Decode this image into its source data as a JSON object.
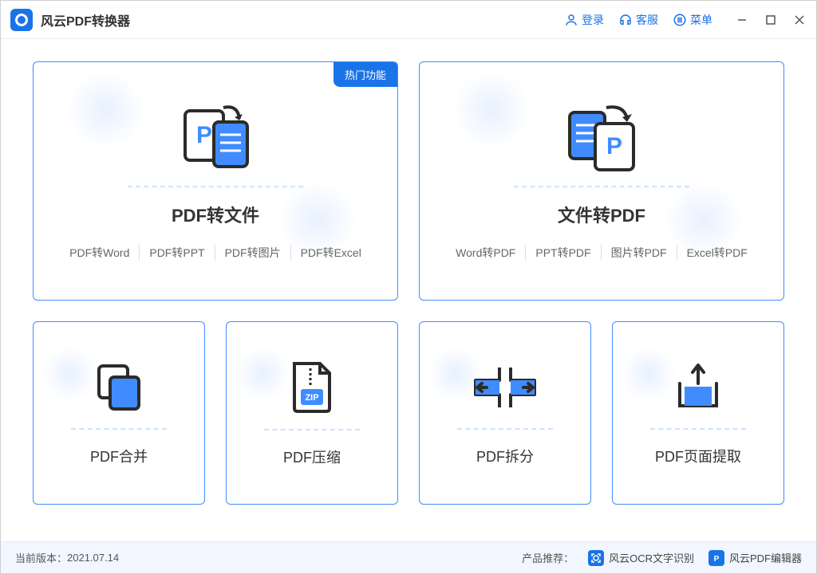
{
  "app": {
    "title": "风云PDF转换器"
  },
  "header": {
    "login": "登录",
    "support": "客服",
    "menu": "菜单"
  },
  "cards": {
    "pdf_to_file": {
      "title": "PDF转文件",
      "badge": "热门功能",
      "subs": [
        "PDF转Word",
        "PDF转PPT",
        "PDF转图片",
        "PDF转Excel"
      ]
    },
    "file_to_pdf": {
      "title": "文件转PDF",
      "subs": [
        "Word转PDF",
        "PPT转PDF",
        "图片转PDF",
        "Excel转PDF"
      ]
    },
    "merge": {
      "title": "PDF合并"
    },
    "compress": {
      "title": "PDF压缩"
    },
    "split": {
      "title": "PDF拆分"
    },
    "extract": {
      "title": "PDF页面提取"
    }
  },
  "footer": {
    "version_label": "当前版本：",
    "version": "2021.07.14",
    "rec_label": "产品推荐：",
    "rec1": "风云OCR文字识别",
    "rec2": "风云PDF编辑器"
  }
}
